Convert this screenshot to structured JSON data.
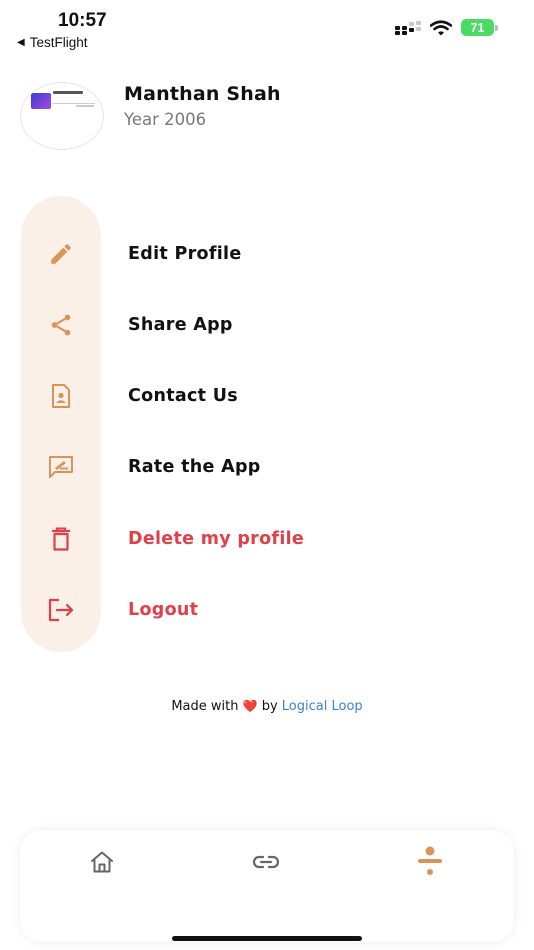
{
  "status_bar": {
    "time": "10:57",
    "back_label": "TestFlight",
    "battery": "71"
  },
  "profile": {
    "name": "Manthan Shah",
    "year": "Year 2006"
  },
  "menu": {
    "items": [
      {
        "label": "Edit Profile",
        "icon": "pencil-icon",
        "danger": false
      },
      {
        "label": "Share App",
        "icon": "share-icon",
        "danger": false
      },
      {
        "label": "Contact Us",
        "icon": "contact-icon",
        "danger": false
      },
      {
        "label": "Rate the App",
        "icon": "rate-feedback-icon",
        "danger": false
      },
      {
        "label": "Delete my profile",
        "icon": "trash-icon",
        "danger": true
      },
      {
        "label": "Logout",
        "icon": "logout-icon",
        "danger": true
      }
    ]
  },
  "footer": {
    "prefix": "Made with",
    "heart": "❤️",
    "by": "by",
    "brand": "Logical Loop"
  },
  "tab_bar": {
    "tabs": [
      {
        "icon": "home-icon",
        "active": false
      },
      {
        "icon": "link-icon",
        "active": false
      },
      {
        "icon": "profile-icon",
        "active": true
      }
    ]
  },
  "colors": {
    "accent": "#d9945a",
    "danger": "#e0404a",
    "rail": "#fbf0e8",
    "link": "#3d7fd6",
    "battery": "#4cd964"
  }
}
